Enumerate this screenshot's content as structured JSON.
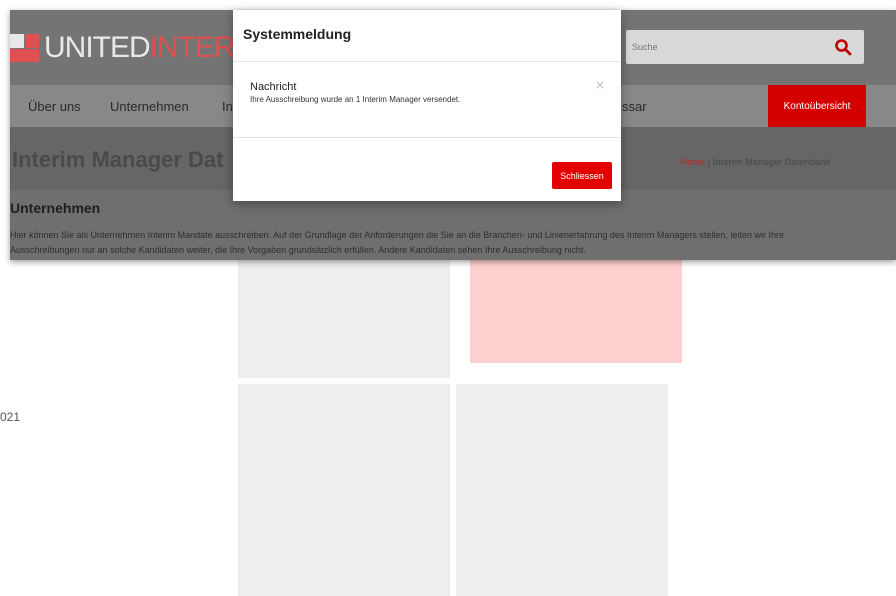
{
  "background": {
    "year_fragment": "021"
  },
  "site": {
    "logo": {
      "part1": "UNITED",
      "part2": "INTERIM"
    },
    "search": {
      "placeholder": "Suche"
    },
    "nav": {
      "items": [
        "Über uns",
        "Unternehmen",
        "In",
        "ssar"
      ],
      "account_button": "Kontoübersicht"
    },
    "hero": {
      "title": "Interim Manager Dat",
      "breadcrumb_home": "Home",
      "breadcrumb_separator": "|",
      "breadcrumb_current": "Interim Manager Datenbank"
    },
    "section": {
      "title": "Unternehmen",
      "text": "Hier können Sie als Unternehmen Interim Mandate ausschreiben. Auf der Grundlage der Anforderungen die Sie an die Branchen- und Linienerfahrung des Interim Managers stellen, leiten wir Ihre Ausschreibungen nur an solche Kandidaten weiter, die Ihre Vorgaben grundsätzlich erfüllen. Andere Kandidaten sehen Ihre Ausschreibung nicht."
    }
  },
  "modal": {
    "title": "Systemmeldung",
    "message_heading": "Nachricht",
    "message_text": "Ihre Ausschreibung wurde an 1 Interim Manager versendet.",
    "close_symbol": "×",
    "close_button": "Schliessen"
  },
  "colors": {
    "accent": "#e30000",
    "overlay": "#6f6f6f"
  },
  "icons": {
    "search": "search-icon",
    "close": "close-icon"
  }
}
